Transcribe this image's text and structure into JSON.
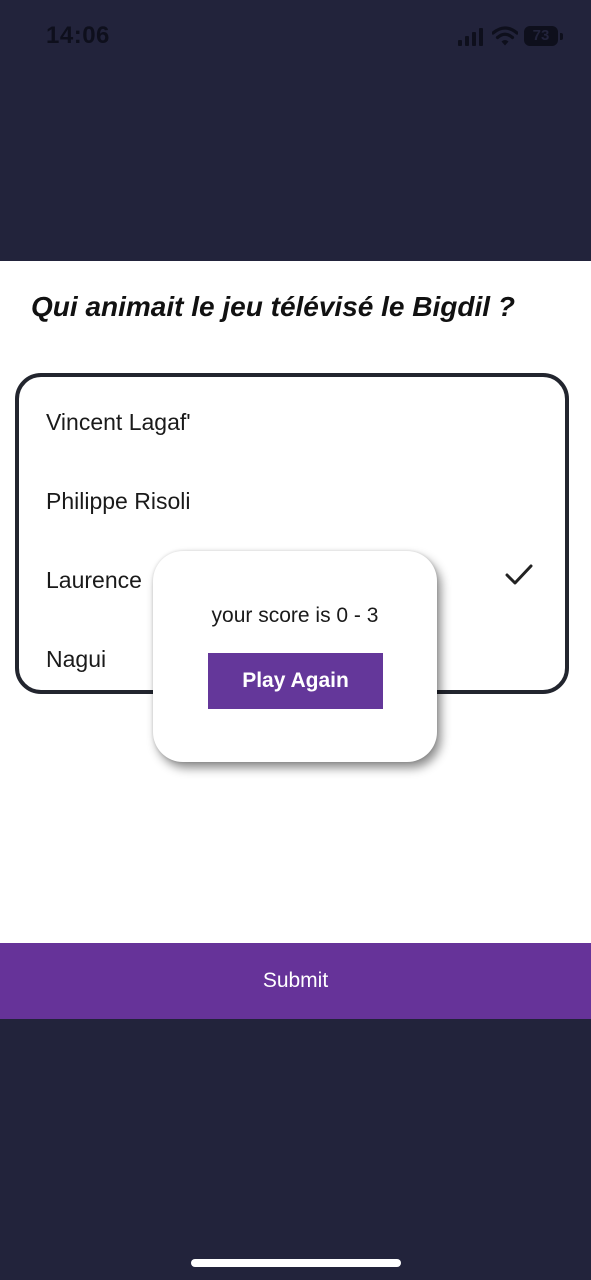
{
  "status_bar": {
    "time": "14:06",
    "battery_level": "73",
    "icons": [
      "signal-icon",
      "wifi-icon",
      "battery-icon"
    ]
  },
  "quiz": {
    "question": "Qui animait le jeu télévisé le Bigdil ?",
    "options": [
      {
        "label": "Vincent Lagaf'"
      },
      {
        "label": "Philippe Risoli"
      },
      {
        "label": "Laurence"
      },
      {
        "label": "Nagui"
      }
    ],
    "selected_option_index": 2,
    "selected_icon": "checkmark-icon"
  },
  "dialog": {
    "score_text": "your score is 0 - 3",
    "play_again_label": "Play Again"
  },
  "footer": {
    "submit_label": "Submit"
  },
  "colors": {
    "background": "#22233b",
    "accent_purple": "#663399",
    "button_purple": "#64379a",
    "options_border": "#22252e",
    "surface": "#ffffff"
  }
}
